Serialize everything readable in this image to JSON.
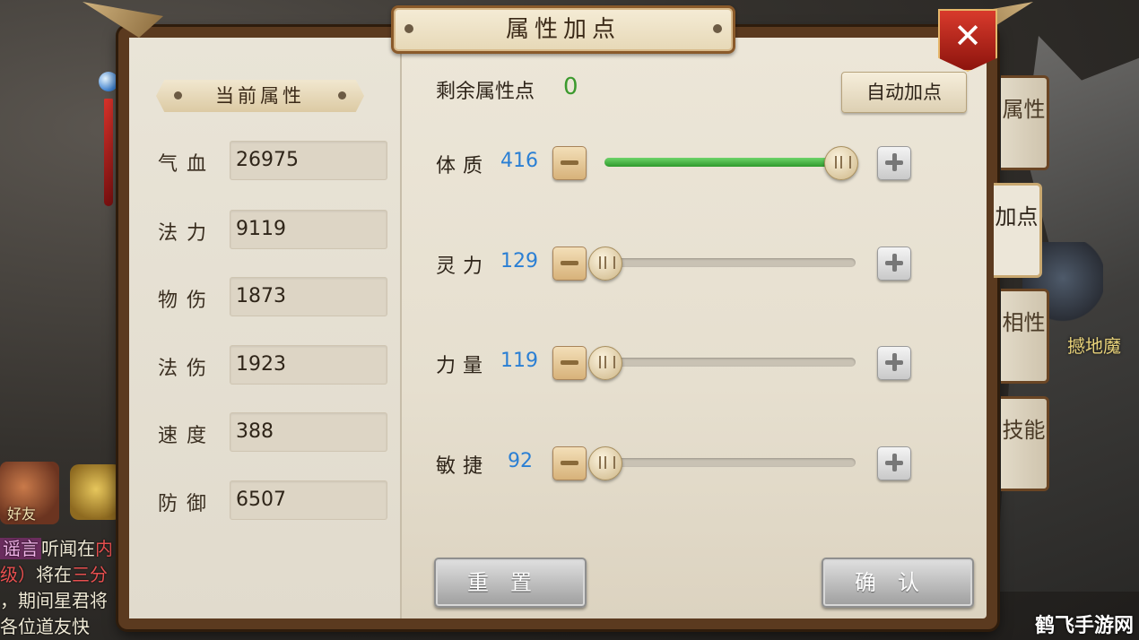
{
  "title": "属性加点",
  "close_label": "✕",
  "left": {
    "section_title": "当前属性",
    "stats": [
      {
        "label": "气血",
        "value": "26975"
      },
      {
        "label": "法力",
        "value": "9119"
      },
      {
        "label": "物伤",
        "value": "1873"
      },
      {
        "label": "法伤",
        "value": "1923"
      },
      {
        "label": "速度",
        "value": "388"
      },
      {
        "label": "防御",
        "value": "6507"
      }
    ]
  },
  "right": {
    "remaining_label": "剩余属性点",
    "remaining_value": "0",
    "auto_button": "自动加点",
    "attributes": [
      {
        "label": "体质",
        "value": "416",
        "level": 0.94
      },
      {
        "label": "灵力",
        "value": "129",
        "level": 0.0
      },
      {
        "label": "力量",
        "value": "119",
        "level": 0.0
      },
      {
        "label": "敏捷",
        "value": "92",
        "level": 0.0
      }
    ],
    "reset_button": "重置",
    "confirm_button": "确认"
  },
  "side_tabs": [
    {
      "label": "属性",
      "active": false
    },
    {
      "label": "加点",
      "active": true
    },
    {
      "label": "相性",
      "active": false
    },
    {
      "label": "技能",
      "active": false
    }
  ],
  "background": {
    "monster_name": "撼地魔",
    "friend_label": "好友",
    "chat": {
      "tag": "谣言",
      "line1": "听闻在",
      "line1_red": "内",
      "line2_red": "级）",
      "line2": "将在",
      "line2_red2": "三分",
      "line3": "，期间星君将",
      "line4": "各位道友快"
    },
    "watermark": "鹤飞手游网"
  },
  "colors": {
    "remaining_green": "#3c9a2e",
    "value_blue": "#2a7fd4",
    "slider_fill": "#2f9a2c",
    "close_red": "#c0261c"
  },
  "icons": [
    "close-icon",
    "minus-icon",
    "plus-icon",
    "slider-knob-icon",
    "friend-icon",
    "chat-icon"
  ]
}
